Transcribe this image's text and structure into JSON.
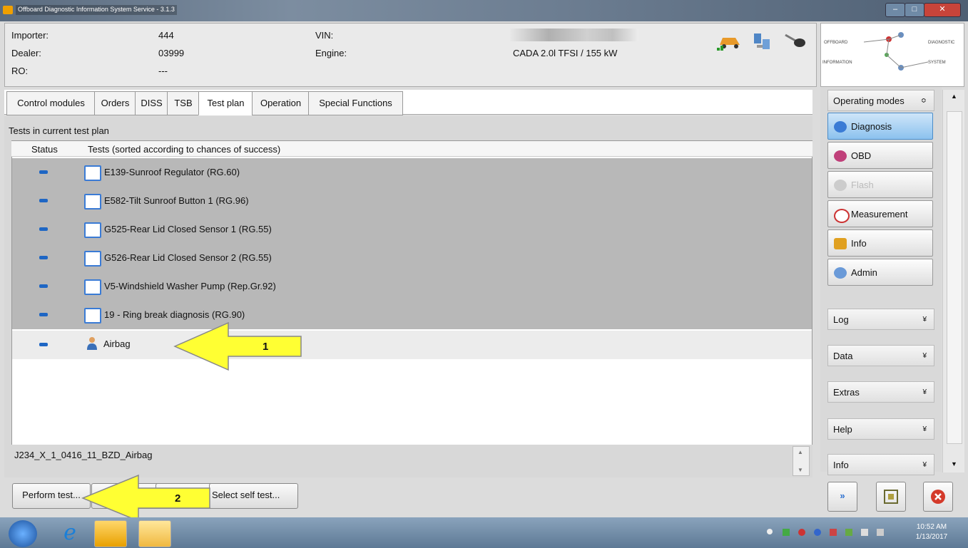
{
  "window": {
    "title": "Offboard Diagnostic Information System Service - 3.1.3"
  },
  "header": {
    "importer_label": "Importer:",
    "importer_value": "444",
    "dealer_label": "Dealer:",
    "dealer_value": "03999",
    "ro_label": "RO:",
    "ro_value": "---",
    "vin_label": "VIN:",
    "engine_label": "Engine:",
    "engine_value": "CADA 2.0l TFSI / 155 kW"
  },
  "logo": {
    "text": "OFFBOARD DIAGNOSTIC INFORMATION SYSTEM"
  },
  "tabs": [
    {
      "label": "Control modules"
    },
    {
      "label": "Orders"
    },
    {
      "label": "DISS"
    },
    {
      "label": "TSB"
    },
    {
      "label": "Test plan"
    },
    {
      "label": "Operation"
    },
    {
      "label": "Special Functions"
    }
  ],
  "main": {
    "caption": "Tests in current test plan",
    "col_status": "Status",
    "col_tests": "Tests (sorted according to chances of success)",
    "rows": [
      {
        "label": "E139-Sunroof Regulator (RG.60)"
      },
      {
        "label": "E582-Tilt Sunroof Button 1 (RG.96)"
      },
      {
        "label": "G525-Rear Lid Closed Sensor 1 (RG.55)"
      },
      {
        "label": "G526-Rear Lid Closed Sensor 2 (RG.55)"
      },
      {
        "label": "V5-Windshield Washer Pump (Rep.Gr.92)"
      },
      {
        "label": "19 - Ring break diagnosis (RG.90)"
      },
      {
        "label": "Airbag"
      }
    ],
    "info_text": "J234_X_1_0416_11_BZD_Airbag"
  },
  "buttons": {
    "perform": "Perform test...",
    "select_self": "Select self test..."
  },
  "annotations": {
    "arrow1": "1",
    "arrow2": "2"
  },
  "sidebar": {
    "operating_modes": "Operating modes",
    "modes": [
      {
        "label": "Diagnosis"
      },
      {
        "label": "OBD"
      },
      {
        "label": "Flash"
      },
      {
        "label": "Measurement"
      },
      {
        "label": "Info"
      },
      {
        "label": "Admin"
      }
    ],
    "sections": [
      {
        "label": "Log"
      },
      {
        "label": "Data"
      },
      {
        "label": "Extras"
      },
      {
        "label": "Help"
      },
      {
        "label": "Info"
      }
    ]
  },
  "taskbar": {
    "time": "10:52 AM",
    "date": "1/13/2017"
  },
  "colors": {
    "accent": "#1e66c4",
    "arrow": "#ffff33",
    "selection": "#b8b8b8"
  }
}
